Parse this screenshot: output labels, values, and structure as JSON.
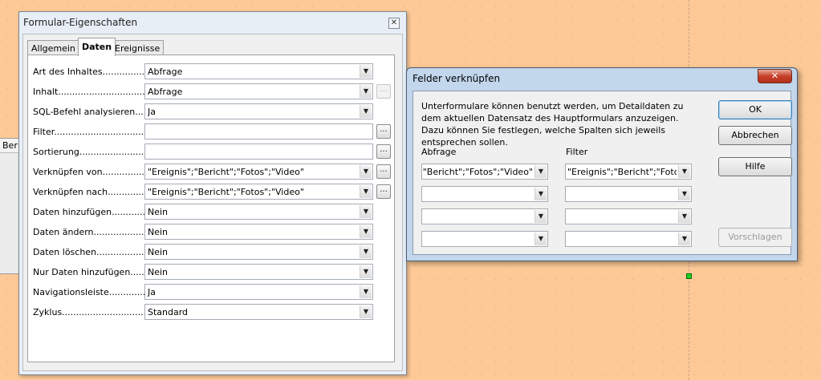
{
  "left_stub": {
    "header": "Ber"
  },
  "props_dialog": {
    "title": "Formular-Eigenschaften",
    "close_glyph": "✕",
    "tabs": [
      "Allgemein",
      "Daten",
      "Ereignisse"
    ],
    "active_tab": "Daten",
    "rows": [
      {
        "label": "Art des Inhaltes................",
        "value": "Abfrage",
        "control": "dropdown",
        "button": ""
      },
      {
        "label": "Inhalt.......................................",
        "value": "Abfrage",
        "control": "dropdown",
        "button": "...",
        "button_enabled": false
      },
      {
        "label": "SQL-Befehl analysieren.....",
        "value": "Ja",
        "control": "dropdown",
        "button": ""
      },
      {
        "label": "Filter.......................................",
        "value": "",
        "control": "text",
        "button": "...",
        "button_enabled": true
      },
      {
        "label": "Sortierung...............................",
        "value": "",
        "control": "text",
        "button": "...",
        "button_enabled": true
      },
      {
        "label": "Verknüpfen von.................",
        "value": "\"Ereignis\";\"Bericht\";\"Fotos\";\"Video\"",
        "control": "dropdown",
        "button": "...",
        "button_enabled": true
      },
      {
        "label": "Verknüpfen nach...............",
        "value": "\"Ereignis\";\"Bericht\";\"Fotos\";\"Video\"",
        "control": "dropdown",
        "button": "...",
        "button_enabled": true
      },
      {
        "label": "Daten hinzufügen.............",
        "value": "Nein",
        "control": "dropdown",
        "button": ""
      },
      {
        "label": "Daten ändern......................",
        "value": "Nein",
        "control": "dropdown",
        "button": ""
      },
      {
        "label": "Daten löschen....................",
        "value": "Nein",
        "control": "dropdown",
        "button": ""
      },
      {
        "label": "Nur Daten hinzufügen.......",
        "value": "Nein",
        "control": "dropdown",
        "button": ""
      },
      {
        "label": "Navigationsleiste..............",
        "value": "Ja",
        "control": "dropdown",
        "button": ""
      },
      {
        "label": "Zyklus...............................................",
        "value": "Standard",
        "control": "dropdown",
        "button": ""
      }
    ]
  },
  "link_dialog": {
    "title": "Felder verknüpfen",
    "close_glyph": "✕",
    "description": "Unterformulare können benutzt werden, um Detaildaten zu dem aktuellen Datensatz des Hauptformulars anzuzeigen. Dazu können Sie festlegen, welche Spalten sich jeweils entsprechen sollen.",
    "col_master": "Abfrage",
    "col_detail": "Filter",
    "master_fields": [
      "\"Ereignis\";\"Bericht\";\"Fotos\";\"Video\"",
      "",
      "",
      ""
    ],
    "detail_fields": [
      "\"Ereignis\";\"Bericht\";\"Fotos\";\"Video\"",
      "",
      "",
      ""
    ],
    "buttons": {
      "ok": "OK",
      "cancel": "Abbrechen",
      "help": "Hilfe",
      "suggest": "Vorschlagen"
    }
  },
  "colors": {
    "canvas": "#fdc996",
    "selection_handle": "#22d022",
    "dialog_frame": "#c2d6ec"
  }
}
